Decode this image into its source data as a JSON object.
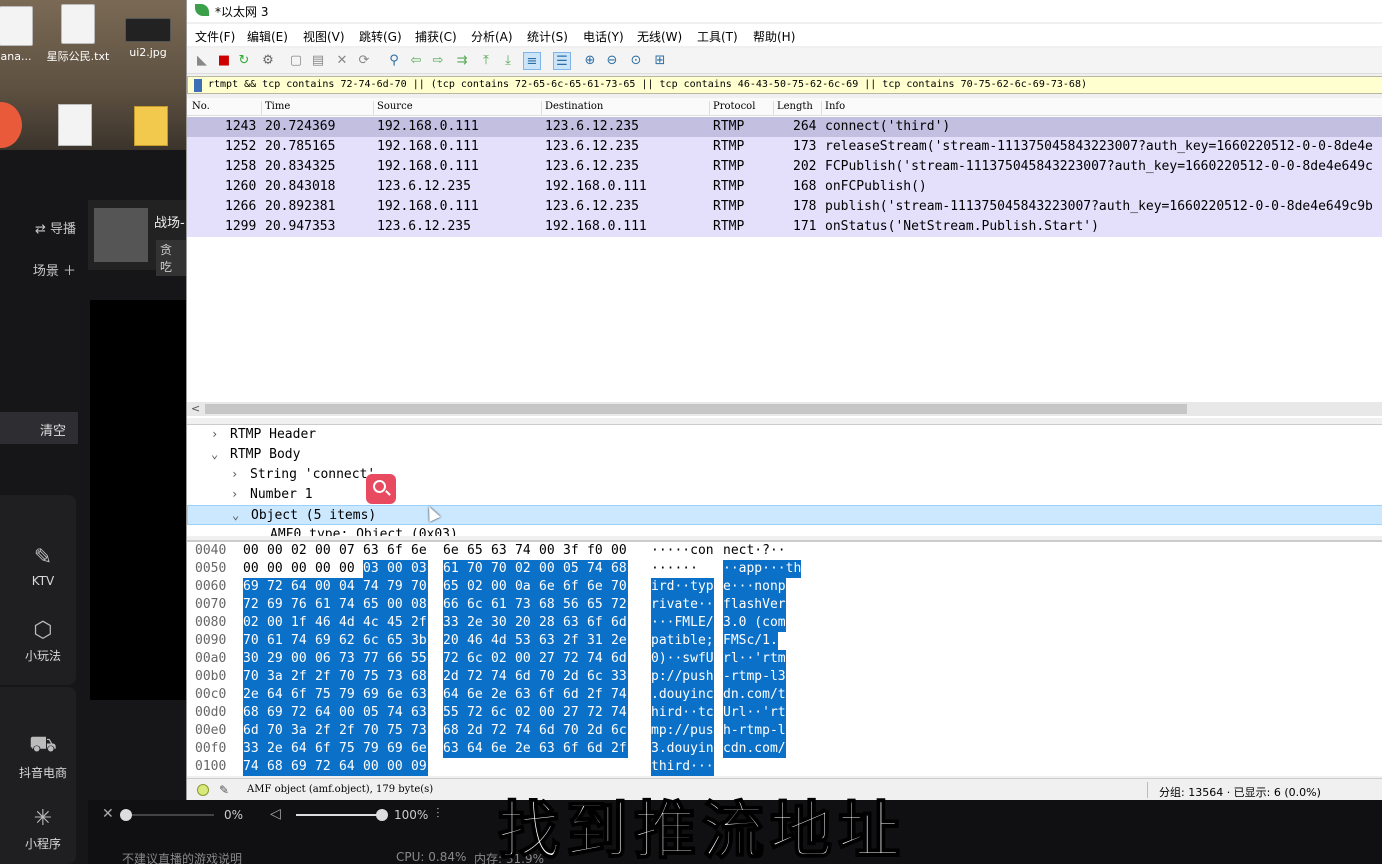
{
  "desktop": {
    "icons": [
      {
        "label": "ana..."
      },
      {
        "label": "星际公民.txt"
      },
      {
        "label": "ui2.jpg"
      }
    ]
  },
  "app": {
    "nav": [
      "⇄ 导播",
      "场景 ＋"
    ],
    "clear": "清空",
    "streamer": {
      "name": "战场-",
      "tag": "贪吃"
    },
    "buttons": [
      {
        "label": "KTV",
        "icon": "microphone-icon"
      },
      {
        "label": "小玩法",
        "icon": "hexagon-icon"
      },
      {
        "label": "抖音电商",
        "icon": "cart-icon"
      },
      {
        "label": "小程序",
        "icon": "sparkle-icon"
      }
    ],
    "volume": [
      {
        "label": "0%",
        "level": 0
      },
      {
        "label": "100%",
        "level": 100
      }
    ],
    "footer": {
      "warn": "不建议直播的游戏说明",
      "cpu": "CPU: 0.84%",
      "mem": "内存: 31.9%"
    }
  },
  "wireshark": {
    "title": "*以太网 3",
    "menu": [
      "文件(F)",
      "编辑(E)",
      "视图(V)",
      "跳转(G)",
      "捕获(C)",
      "分析(A)",
      "统计(S)",
      "电话(Y)",
      "无线(W)",
      "工具(T)",
      "帮助(H)"
    ],
    "filter": "rtmpt && tcp contains 72-74-6d-70 || (tcp contains 72-65-6c-65-61-73-65 || tcp contains 46-43-50-75-62-6c-69 || tcp contains 70-75-62-6c-69-73-68)",
    "columns": [
      "No.",
      "Time",
      "Source",
      "Destination",
      "Protocol",
      "Length",
      "Info"
    ],
    "packets": [
      {
        "no": "1243",
        "time": "20.724369",
        "src": "192.168.0.111",
        "dst": "123.6.12.235",
        "proto": "RTMP",
        "len": "264",
        "info": "connect('third')"
      },
      {
        "no": "1252",
        "time": "20.785165",
        "src": "192.168.0.111",
        "dst": "123.6.12.235",
        "proto": "RTMP",
        "len": "173",
        "info": "releaseStream('stream-111375045843223007?auth_key=1660220512-0-0-8de4e"
      },
      {
        "no": "1258",
        "time": "20.834325",
        "src": "192.168.0.111",
        "dst": "123.6.12.235",
        "proto": "RTMP",
        "len": "202",
        "info": "FCPublish('stream-111375045843223007?auth_key=1660220512-0-0-8de4e649c"
      },
      {
        "no": "1260",
        "time": "20.843018",
        "src": "123.6.12.235",
        "dst": "192.168.0.111",
        "proto": "RTMP",
        "len": "168",
        "info": "onFCPublish()"
      },
      {
        "no": "1266",
        "time": "20.892381",
        "src": "192.168.0.111",
        "dst": "123.6.12.235",
        "proto": "RTMP",
        "len": "178",
        "info": "publish('stream-111375045843223007?auth_key=1660220512-0-0-8de4e649c9b"
      },
      {
        "no": "1299",
        "time": "20.947353",
        "src": "123.6.12.235",
        "dst": "192.168.0.111",
        "proto": "RTMP",
        "len": "171",
        "info": "onStatus('NetStream.Publish.Start')"
      }
    ],
    "details": [
      {
        "text": "RTMP Header",
        "caret": ">",
        "indent": 0
      },
      {
        "text": "RTMP Body",
        "caret": "v",
        "indent": 0
      },
      {
        "text": "String 'connect'",
        "caret": ">",
        "indent": 1
      },
      {
        "text": "Number 1",
        "caret": ">",
        "indent": 1
      },
      {
        "text": "Object (5 items)",
        "caret": "v",
        "indent": 1,
        "selected": true
      },
      {
        "text": "AMF0 type: Object (0x03)",
        "caret": "",
        "indent": 2
      }
    ],
    "hex": [
      {
        "off": "0040",
        "bytes": [
          "00",
          "00",
          "02",
          "00",
          "07",
          "63",
          "6f",
          "6e",
          "6e",
          "65",
          "63",
          "74",
          "00",
          "3f",
          "f0",
          "00"
        ],
        "hlFrom": 16,
        "ascii": [
          "·····con",
          "nect·?··"
        ]
      },
      {
        "off": "0050",
        "bytes": [
          "00",
          "00",
          "00",
          "00",
          "00",
          "03",
          "00",
          "03",
          "61",
          "70",
          "70",
          "02",
          "00",
          "05",
          "74",
          "68"
        ],
        "hlFrom": 5,
        "ascii": [
          "······",
          "··app···th"
        ]
      },
      {
        "off": "0060",
        "bytes": [
          "69",
          "72",
          "64",
          "00",
          "04",
          "74",
          "79",
          "70",
          "65",
          "02",
          "00",
          "0a",
          "6e",
          "6f",
          "6e",
          "70"
        ],
        "hlFrom": 0,
        "ascii": [
          "ird··typ",
          "e···nonp"
        ]
      },
      {
        "off": "0070",
        "bytes": [
          "72",
          "69",
          "76",
          "61",
          "74",
          "65",
          "00",
          "08",
          "66",
          "6c",
          "61",
          "73",
          "68",
          "56",
          "65",
          "72"
        ],
        "hlFrom": 0,
        "ascii": [
          "rivate··",
          "flashVer"
        ]
      },
      {
        "off": "0080",
        "bytes": [
          "02",
          "00",
          "1f",
          "46",
          "4d",
          "4c",
          "45",
          "2f",
          "33",
          "2e",
          "30",
          "20",
          "28",
          "63",
          "6f",
          "6d"
        ],
        "hlFrom": 0,
        "ascii": [
          "···FMLE/",
          "3.0 (com"
        ]
      },
      {
        "off": "0090",
        "bytes": [
          "70",
          "61",
          "74",
          "69",
          "62",
          "6c",
          "65",
          "3b",
          "20",
          "46",
          "4d",
          "53",
          "63",
          "2f",
          "31",
          "2e"
        ],
        "hlFrom": 0,
        "ascii": [
          "patible;",
          " FMSc/1."
        ]
      },
      {
        "off": "00a0",
        "bytes": [
          "30",
          "29",
          "00",
          "06",
          "73",
          "77",
          "66",
          "55",
          "72",
          "6c",
          "02",
          "00",
          "27",
          "72",
          "74",
          "6d"
        ],
        "hlFrom": 0,
        "ascii": [
          "0)··swfU",
          "rl··'rtm"
        ]
      },
      {
        "off": "00b0",
        "bytes": [
          "70",
          "3a",
          "2f",
          "2f",
          "70",
          "75",
          "73",
          "68",
          "2d",
          "72",
          "74",
          "6d",
          "70",
          "2d",
          "6c",
          "33"
        ],
        "hlFrom": 0,
        "ascii": [
          "p://push",
          "-rtmp-l3"
        ]
      },
      {
        "off": "00c0",
        "bytes": [
          "2e",
          "64",
          "6f",
          "75",
          "79",
          "69",
          "6e",
          "63",
          "64",
          "6e",
          "2e",
          "63",
          "6f",
          "6d",
          "2f",
          "74"
        ],
        "hlFrom": 0,
        "ascii": [
          ".douyinc",
          "dn.com/t"
        ]
      },
      {
        "off": "00d0",
        "bytes": [
          "68",
          "69",
          "72",
          "64",
          "00",
          "05",
          "74",
          "63",
          "55",
          "72",
          "6c",
          "02",
          "00",
          "27",
          "72",
          "74"
        ],
        "hlFrom": 0,
        "ascii": [
          "hird··tc",
          "Url··'rt"
        ]
      },
      {
        "off": "00e0",
        "bytes": [
          "6d",
          "70",
          "3a",
          "2f",
          "2f",
          "70",
          "75",
          "73",
          "68",
          "2d",
          "72",
          "74",
          "6d",
          "70",
          "2d",
          "6c"
        ],
        "hlFrom": 0,
        "ascii": [
          "mp://pus",
          "h-rtmp-l"
        ]
      },
      {
        "off": "00f0",
        "bytes": [
          "33",
          "2e",
          "64",
          "6f",
          "75",
          "79",
          "69",
          "6e",
          "63",
          "64",
          "6e",
          "2e",
          "63",
          "6f",
          "6d",
          "2f"
        ],
        "hlFrom": 0,
        "ascii": [
          "3.douyin",
          "cdn.com/"
        ]
      },
      {
        "off": "0100",
        "bytes": [
          "74",
          "68",
          "69",
          "72",
          "64",
          "00",
          "00",
          "09"
        ],
        "hlFrom": 0,
        "ascii": [
          "third···",
          ""
        ]
      }
    ],
    "status": {
      "left": "AMF object (amf.object), 179 byte(s)",
      "right": "分组: 13564 · 已显示: 6 (0.0%)"
    }
  },
  "caption": "找到推流地址",
  "colors": {
    "rowBg": "#e4e0fb",
    "rowSel": "#c2bfe0",
    "hexHl": "#0a70c8",
    "filterBg": "#ffffd0"
  }
}
